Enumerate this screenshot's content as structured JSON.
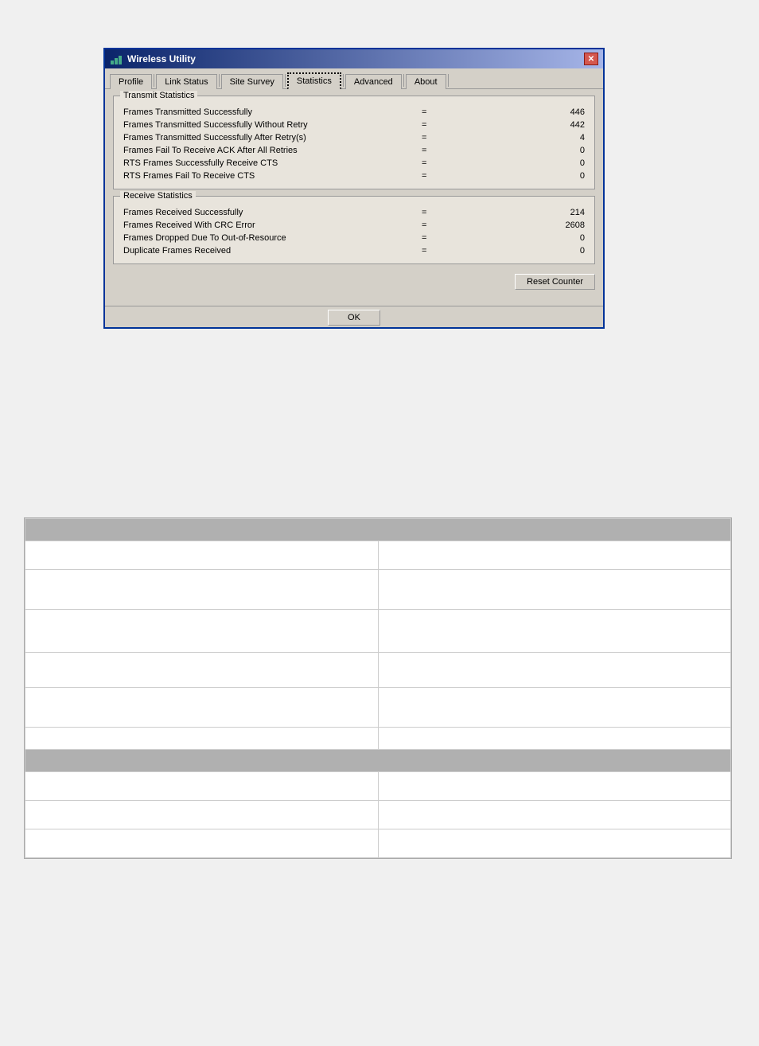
{
  "window": {
    "title": "Wireless Utility",
    "close_label": "✕"
  },
  "tabs": [
    {
      "label": "Profile",
      "active": false
    },
    {
      "label": "Link Status",
      "active": false
    },
    {
      "label": "Site Survey",
      "active": false
    },
    {
      "label": "Statistics",
      "active": true
    },
    {
      "label": "Advanced",
      "active": false
    },
    {
      "label": "About",
      "active": false
    }
  ],
  "transmit": {
    "section_title": "Transmit Statistics",
    "rows": [
      {
        "label": "Frames Transmitted Successfully",
        "eq": "=",
        "value": "446"
      },
      {
        "label": "Frames Transmitted Successfully  Without Retry",
        "eq": "=",
        "value": "442"
      },
      {
        "label": "Frames Transmitted Successfully After Retry(s)",
        "eq": "=",
        "value": "4"
      },
      {
        "label": "Frames Fail To Receive ACK After All Retries",
        "eq": "=",
        "value": "0"
      },
      {
        "label": "RTS Frames Successfully Receive CTS",
        "eq": "=",
        "value": "0"
      },
      {
        "label": "RTS Frames Fail To Receive CTS",
        "eq": "=",
        "value": "0"
      }
    ]
  },
  "receive": {
    "section_title": "Receive Statistics",
    "rows": [
      {
        "label": "Frames Received Successfully",
        "eq": "=",
        "value": "214"
      },
      {
        "label": "Frames Received With CRC Error",
        "eq": "=",
        "value": "2608"
      },
      {
        "label": "Frames Dropped Due To Out-of-Resource",
        "eq": "=",
        "value": "0"
      },
      {
        "label": "Duplicate Frames Received",
        "eq": "=",
        "value": "0"
      }
    ]
  },
  "buttons": {
    "reset_counter": "Reset Counter",
    "ok": "OK"
  }
}
